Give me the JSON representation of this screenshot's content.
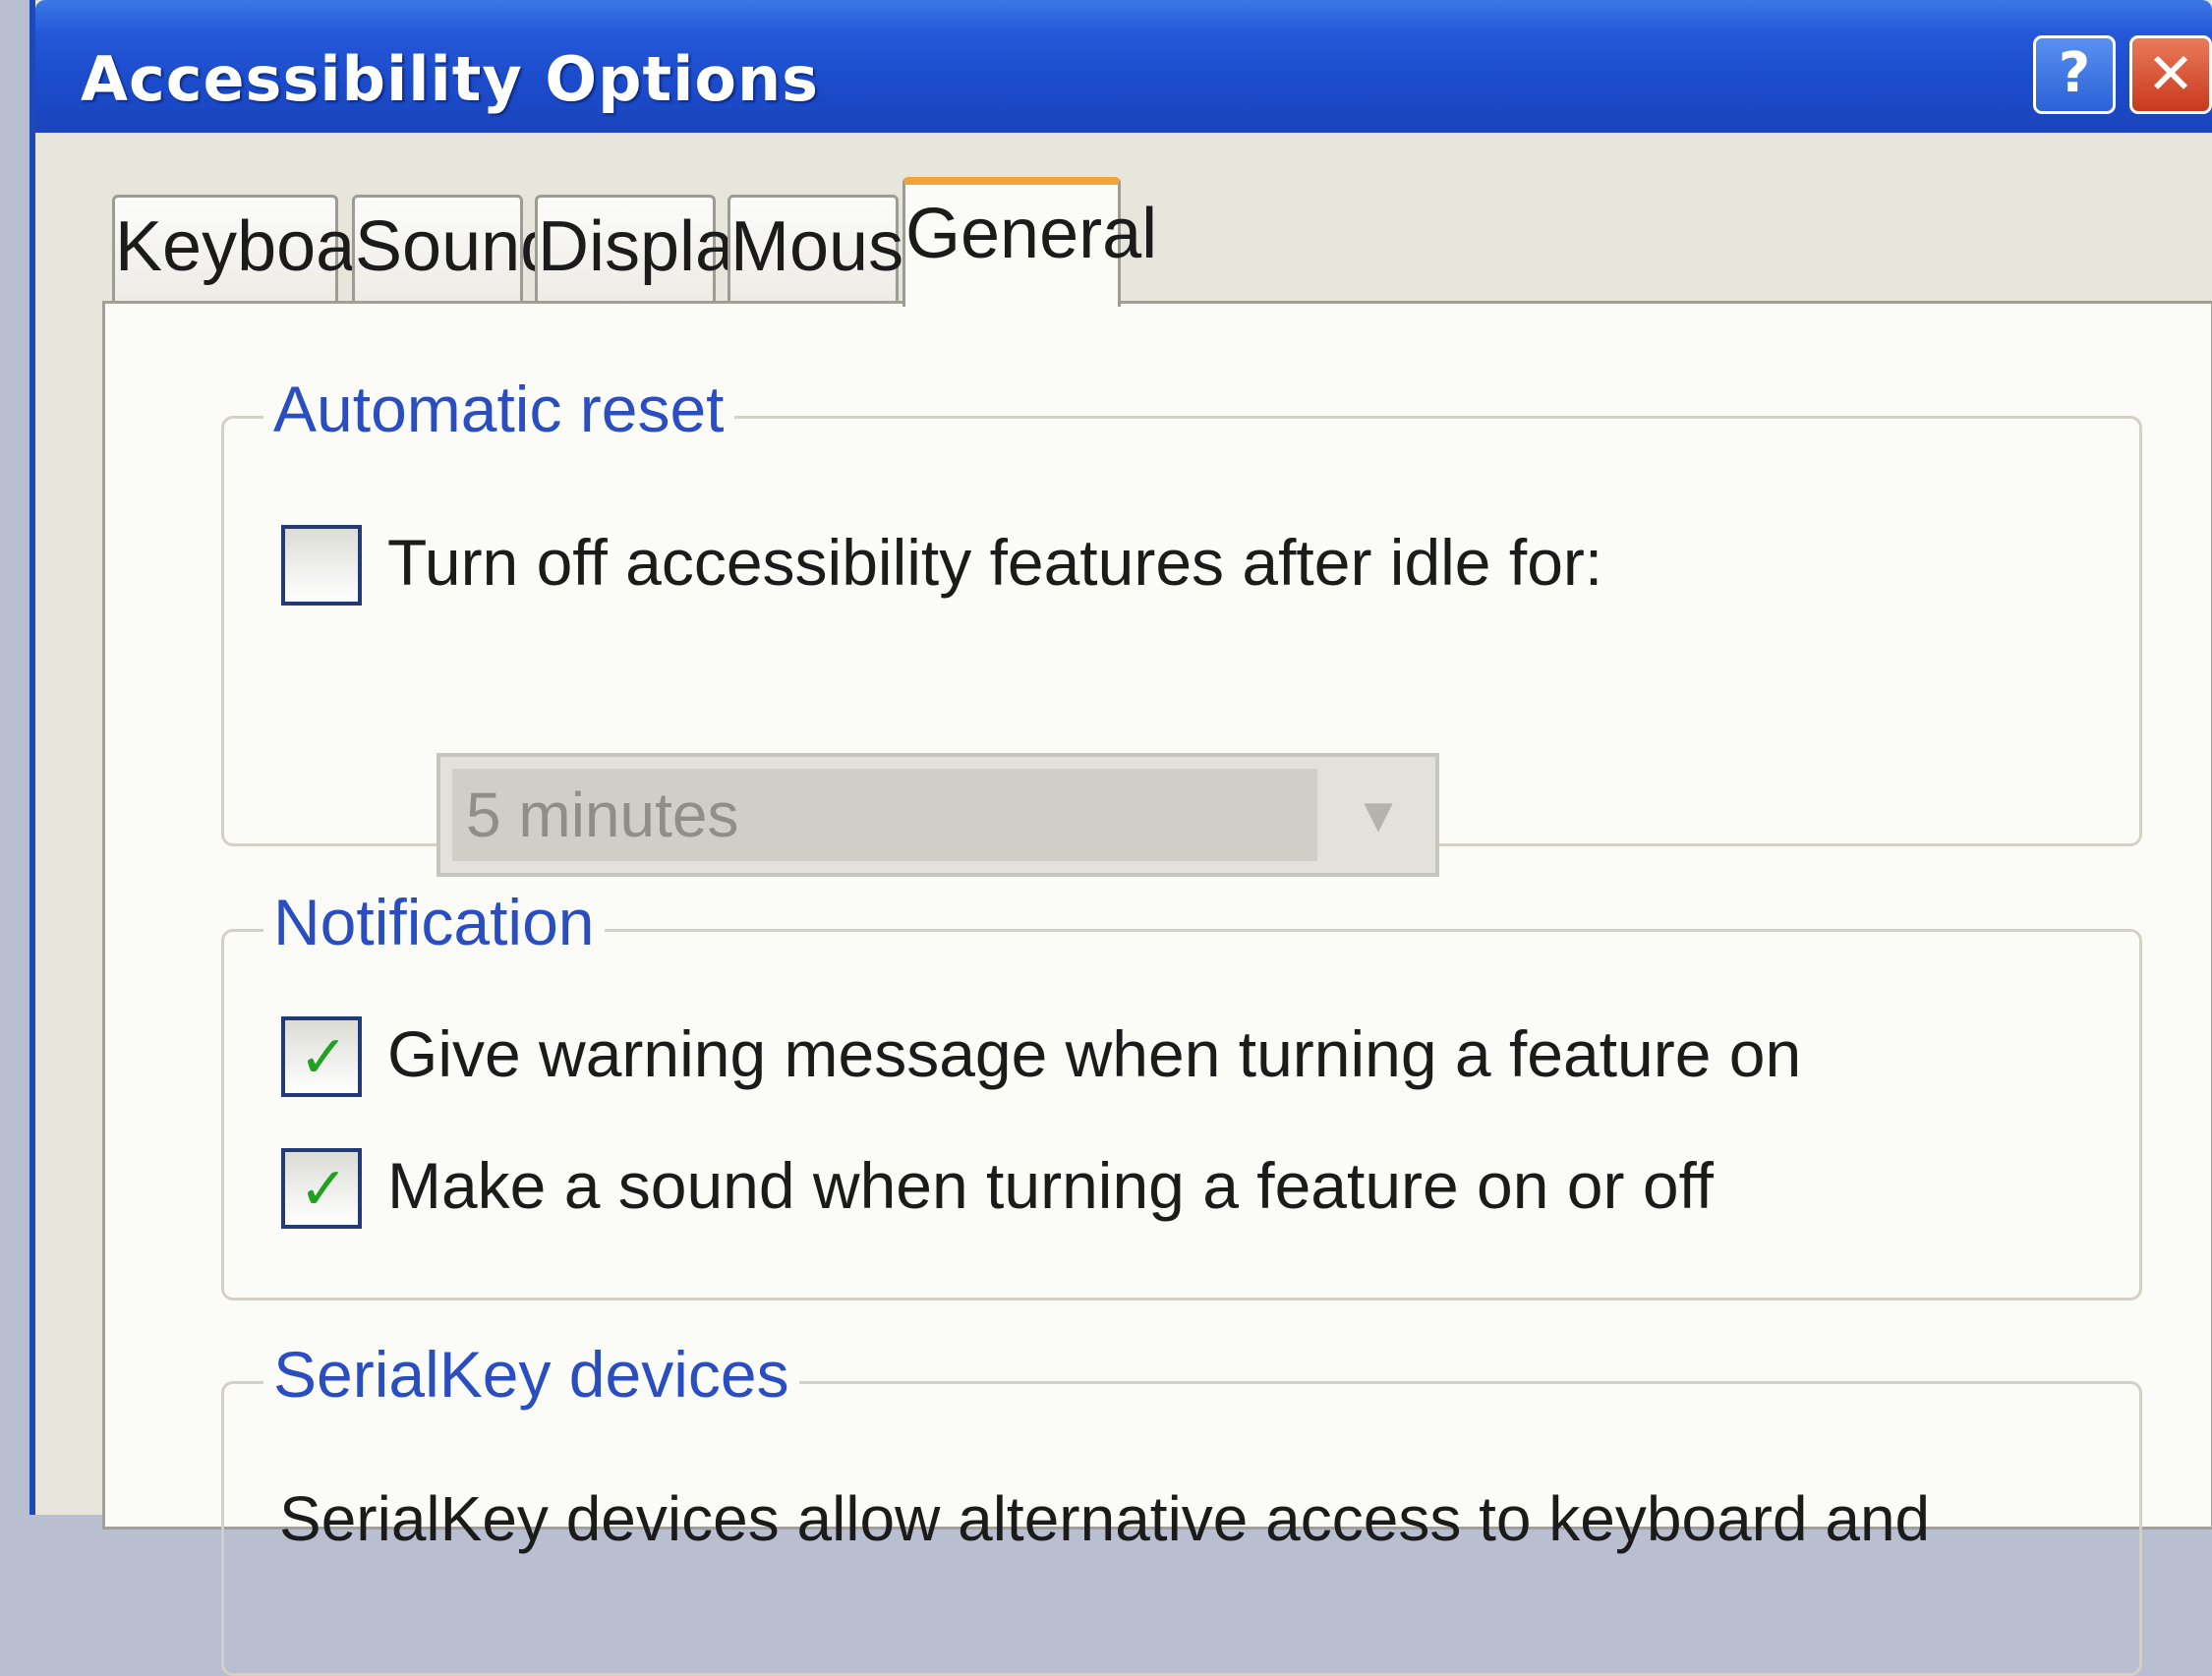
{
  "window": {
    "title": "Accessibility Options"
  },
  "caption_buttons": {
    "help": "?",
    "close": "✕"
  },
  "tabs": [
    {
      "label": "Keyboard",
      "active": false
    },
    {
      "label": "Sound",
      "active": false
    },
    {
      "label": "Display",
      "active": false
    },
    {
      "label": "Mouse",
      "active": false
    },
    {
      "label": "General",
      "active": true
    }
  ],
  "automatic_reset": {
    "title": "Automatic reset",
    "checkbox": {
      "label": "Turn off accessibility features after idle for:",
      "checked": false
    },
    "idle_select": {
      "value": "5 minutes",
      "disabled": true
    }
  },
  "notification": {
    "title": "Notification",
    "warning": {
      "label": "Give warning message when turning a feature on",
      "checked": true
    },
    "sound": {
      "label": "Make a sound when turning a feature on or off",
      "checked": true
    }
  },
  "serialkey": {
    "title": "SerialKey devices",
    "description": "SerialKey devices allow alternative access to keyboard and"
  },
  "icons": {
    "check": "checkmark-icon",
    "dropdown": "chevron-down-icon",
    "help": "help-icon",
    "close": "close-icon"
  },
  "colors": {
    "title_bar": "#1c4ccc",
    "group_label": "#2a4ec0",
    "active_tab_accent": "#f2a33a",
    "check": "#21a121",
    "close_button": "#c8391e"
  }
}
